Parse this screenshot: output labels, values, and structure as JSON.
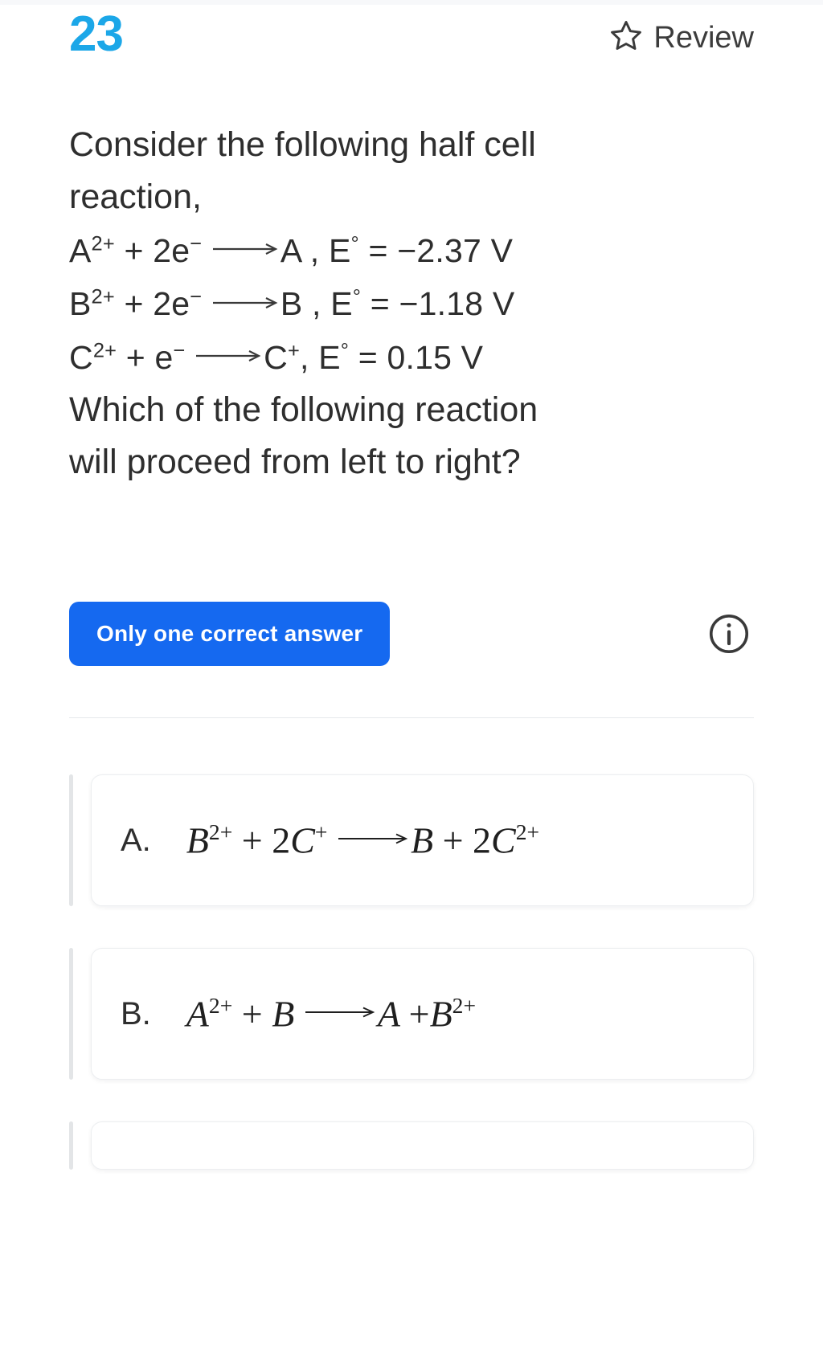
{
  "header": {
    "question_number": "23",
    "review_label": "Review",
    "star_icon": "star-outline-icon",
    "number_color": "#1CA7E8"
  },
  "question": {
    "text_line_1": "Consider the following half cell",
    "text_line_2": "reaction,",
    "equations": [
      {
        "id": "eq-a",
        "reactant_symbol": "A",
        "reactant_charge": "2+",
        "electrons": "+ 2e",
        "electron_charge": "−",
        "product": "A",
        "potential_label": "E",
        "potential_degree": "°",
        "potential_value": "−2.37 V",
        "plain": "A2+ + 2e− ⟶ A , E° = −2.37 V"
      },
      {
        "id": "eq-b",
        "reactant_symbol": "B",
        "reactant_charge": "2+",
        "electrons": "+ 2e",
        "electron_charge": "−",
        "product": "B",
        "potential_label": "E",
        "potential_degree": "°",
        "potential_value": "−1.18 V",
        "plain": "B2+ + 2e− ⟶ B , E° = −1.18 V"
      },
      {
        "id": "eq-c",
        "reactant_symbol": "C",
        "reactant_charge": "2+",
        "electrons": "+ e",
        "electron_charge": "−",
        "product": "C",
        "product_charge": "+",
        "potential_label": "E",
        "potential_degree": "°",
        "potential_value": "0.15 V",
        "plain": "C2+ + e− ⟶ C+, E° = 0.15 V"
      }
    ],
    "text_line_3": "Which of the following reaction",
    "text_line_4": "will proceed from left to right?"
  },
  "meta": {
    "badge_label": "Only one correct answer",
    "badge_color": "#1569F0",
    "info_icon": "info-circle-icon"
  },
  "options": [
    {
      "letter": "A.",
      "math_plain": "B2+ + 2C+ ⟶ B + 2C2+",
      "parts": {
        "t1": "B",
        "s1": "2+",
        "t2": "+ 2",
        "t3": "C",
        "s3": "+",
        "t4": "B",
        "t5": "+ 2",
        "t6": "C",
        "s6": "2+"
      }
    },
    {
      "letter": "B.",
      "math_plain": "A2+ + B ⟶ A + B2+",
      "parts": {
        "t1": "A",
        "s1": "2+",
        "t2": "+",
        "t3": "B",
        "s3": "",
        "t4": "A",
        "t5": "+",
        "t6": "B",
        "s6": "2+"
      }
    }
  ]
}
